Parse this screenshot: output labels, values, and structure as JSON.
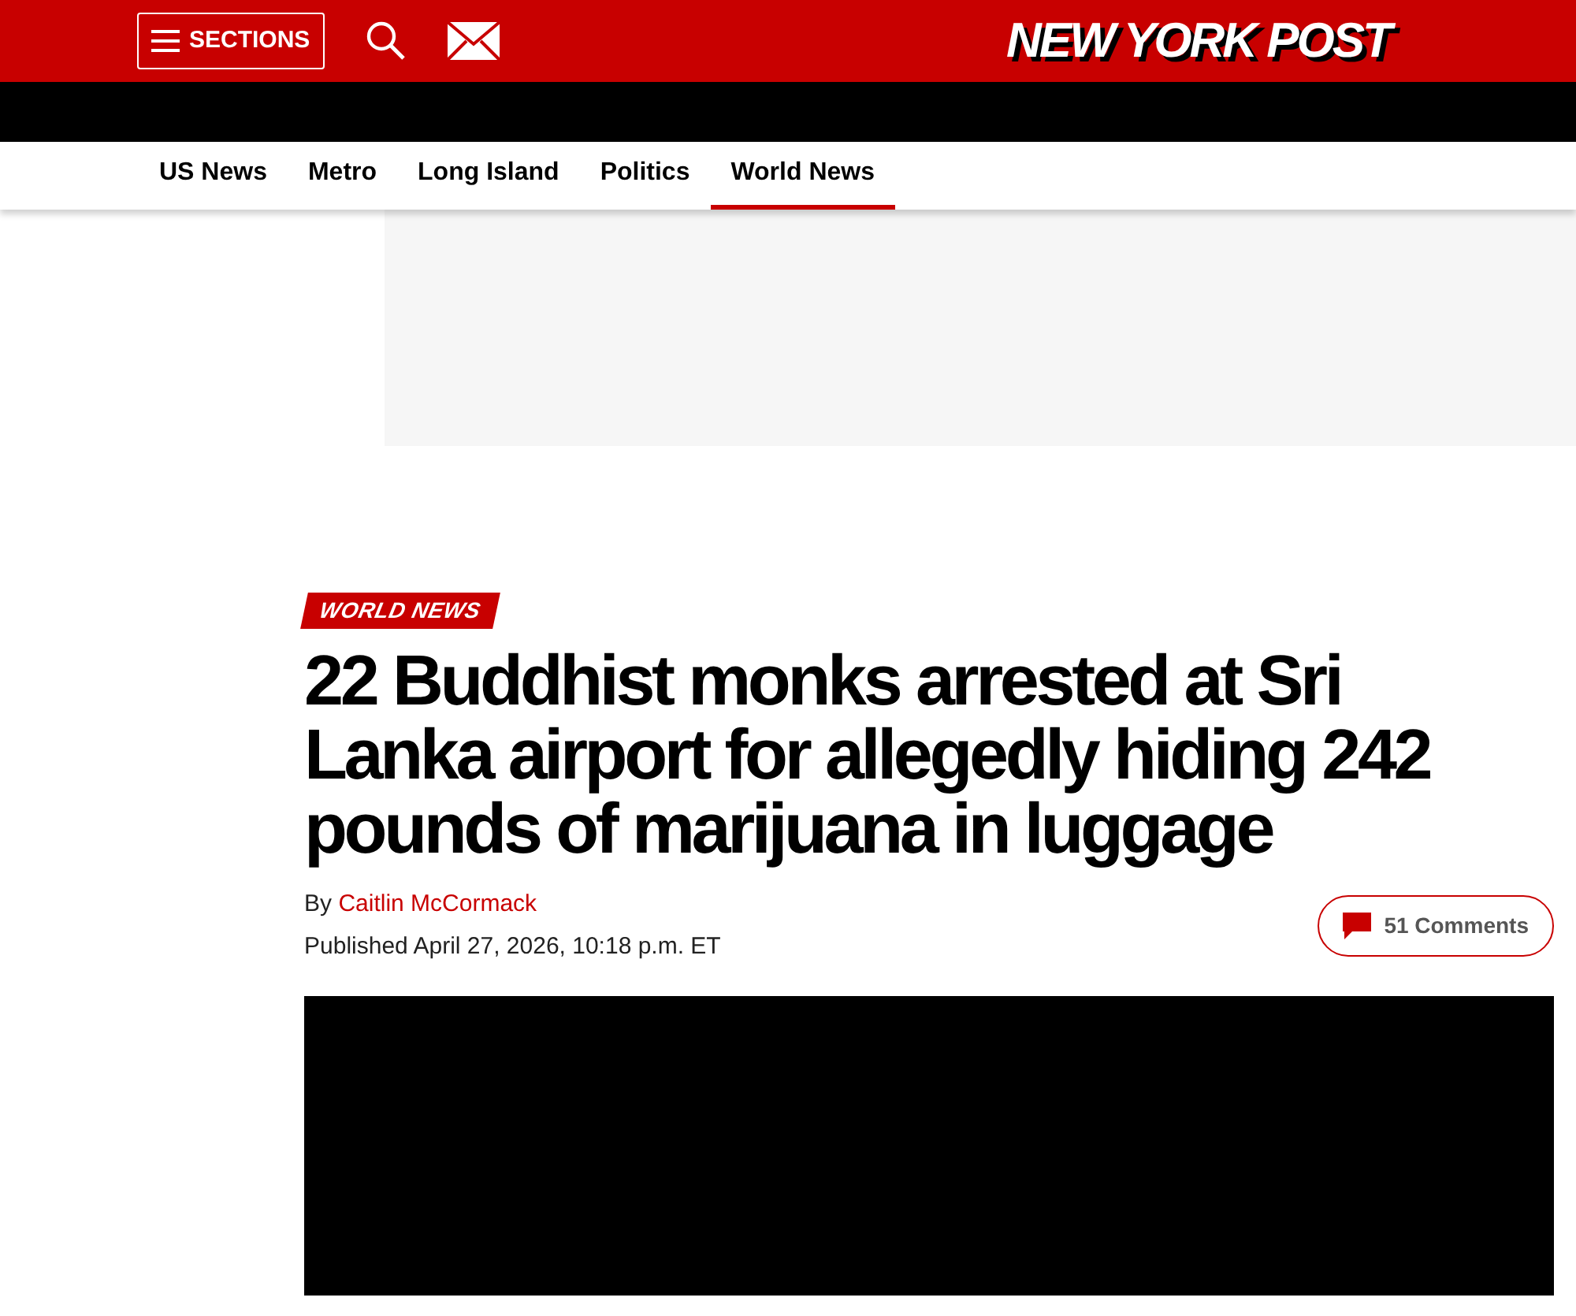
{
  "header": {
    "sections_button": "SECTIONS",
    "logo": "NEW YORK POST"
  },
  "nav": [
    {
      "label": "US News",
      "selected": false
    },
    {
      "label": "Metro",
      "selected": false
    },
    {
      "label": "Long Island",
      "selected": false
    },
    {
      "label": "Politics",
      "selected": false
    },
    {
      "label": "World News",
      "selected": true
    }
  ],
  "article": {
    "category": "WORLD NEWS",
    "headline": "22 Buddhist monks arrested at Sri Lanka airport for allegedly hiding 242 pounds of marijuana in luggage",
    "byline_prefix": "By",
    "author": "Caitlin McCormack",
    "published": "Published April 27, 2026, 10:18 p.m. ET",
    "comments": "51 Comments"
  }
}
